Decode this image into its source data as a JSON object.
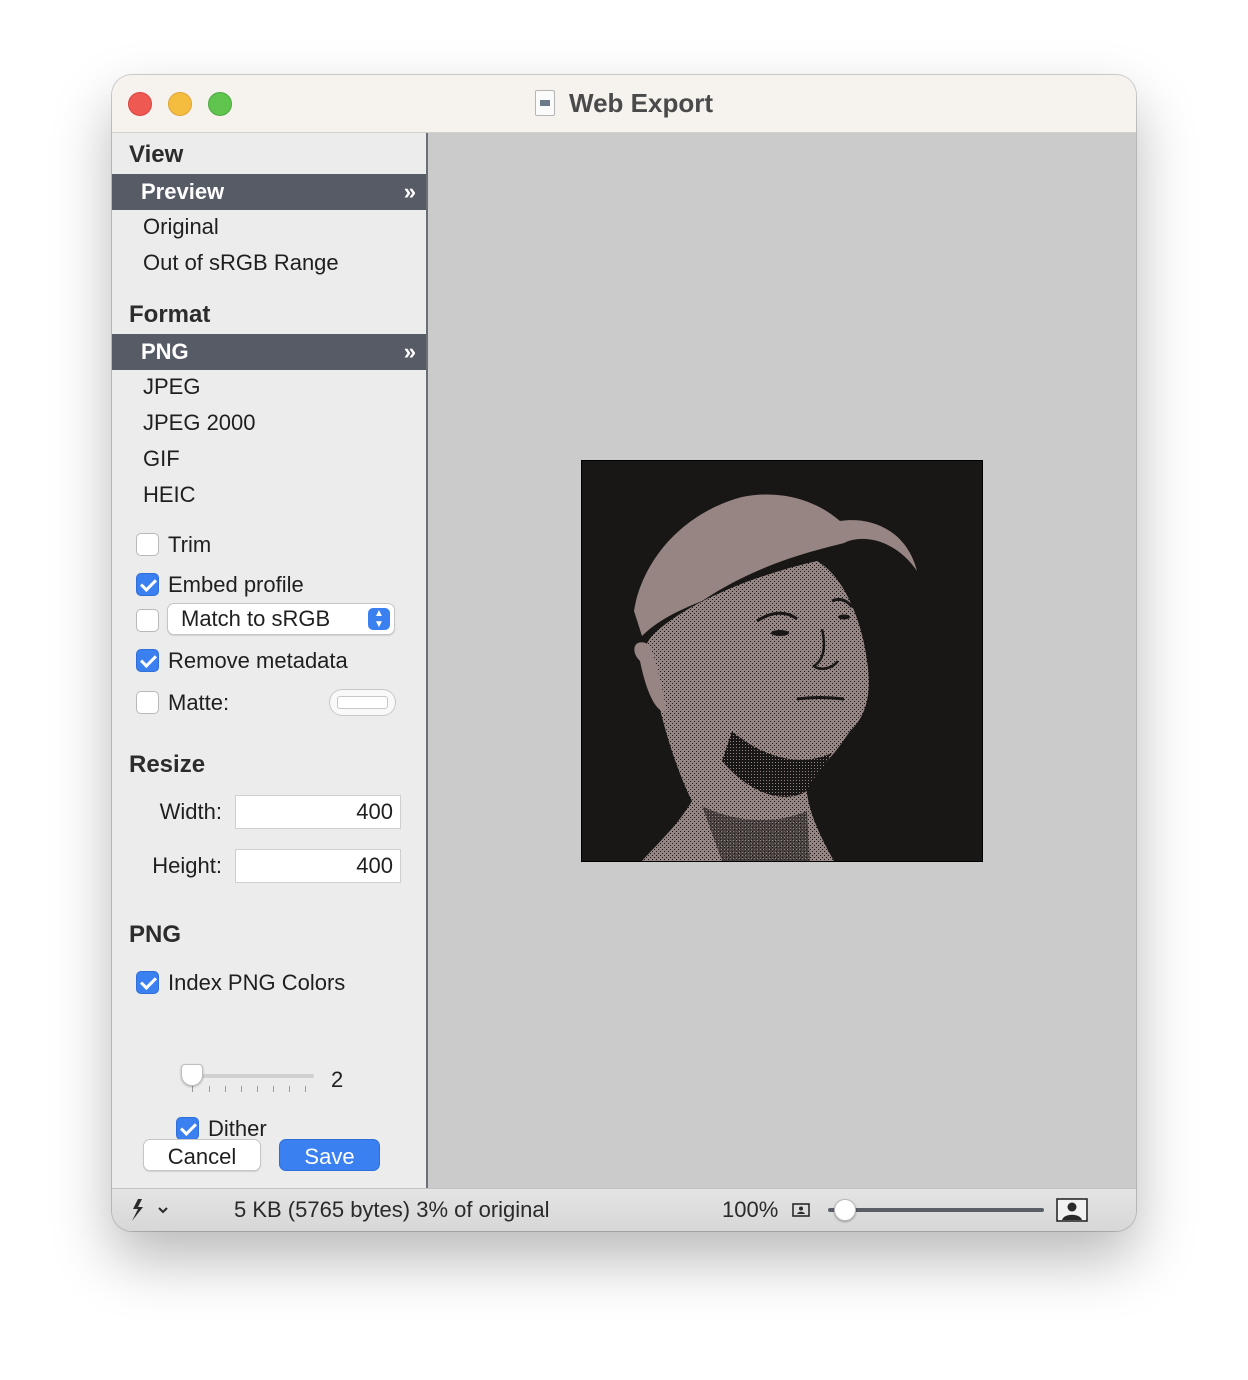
{
  "window": {
    "title": "Web Export"
  },
  "sidebar": {
    "view": {
      "heading": "View",
      "items": [
        {
          "label": "Preview",
          "selected": true
        },
        {
          "label": "Original",
          "selected": false
        },
        {
          "label": "Out of sRGB Range",
          "selected": false
        }
      ]
    },
    "format": {
      "heading": "Format",
      "items": [
        {
          "label": "PNG",
          "selected": true
        },
        {
          "label": "JPEG",
          "selected": false
        },
        {
          "label": "JPEG 2000",
          "selected": false
        },
        {
          "label": "GIF",
          "selected": false
        },
        {
          "label": "HEIC",
          "selected": false
        }
      ]
    },
    "selected_chevron": "»",
    "options": {
      "trim": {
        "label": "Trim",
        "checked": false
      },
      "embed_profile": {
        "label": "Embed profile",
        "checked": true
      },
      "match": {
        "checked": false,
        "popup_value": "Match to sRGB"
      },
      "remove_metadata": {
        "label": "Remove metadata",
        "checked": true
      },
      "matte": {
        "label": "Matte:",
        "checked": false,
        "color": "#ffffff"
      }
    },
    "resize": {
      "heading": "Resize",
      "width_label": "Width:",
      "width_value": "400",
      "height_label": "Height:",
      "height_value": "400"
    },
    "png": {
      "heading": "PNG",
      "index_colors": {
        "label": "Index PNG Colors",
        "checked": true
      },
      "colors_value": "2",
      "dither": {
        "label": "Dither",
        "checked": true
      }
    },
    "buttons": {
      "cancel": "Cancel",
      "save": "Save"
    }
  },
  "statusbar": {
    "file_info": "5 KB (5765 bytes) 3% of original",
    "zoom": "100%",
    "zoom_slider_level": 0.05
  },
  "colors": {
    "accent": "#3b80f0",
    "selection": "#575b66",
    "preview_bg": "#cbcbcb",
    "duotone_light": "#978583",
    "duotone_dark": "#181715"
  },
  "icons": {
    "window_doc": "document-icon",
    "actions": "action-gear-icon",
    "fit": "fit-to-window-icon",
    "actual_size": "actual-size-person-icon"
  }
}
